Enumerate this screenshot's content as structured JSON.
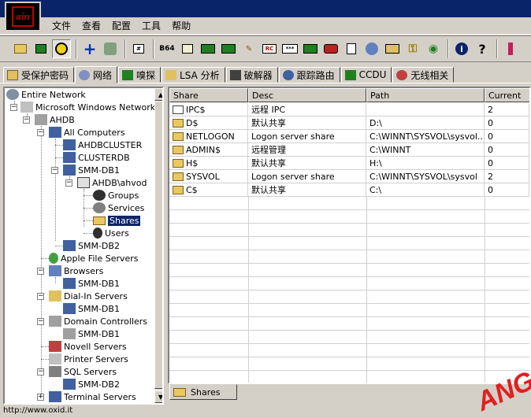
{
  "app": {
    "icon_text": "ain"
  },
  "menu": [
    "文件",
    "查看",
    "配置",
    "工具",
    "帮助"
  ],
  "toolbar": {
    "icons": [
      "open-icon",
      "network-card-icon",
      "sniffer-hazard-icon",
      "add-icon",
      "recycle-icon",
      "hash-icon",
      "base64-icon",
      "lm-hash-icon",
      "mac-icon",
      "pwl-icon",
      "rdp-icon",
      "password-stars-icon",
      "console-icon",
      "mask-icon",
      "certificate-icon",
      "cisco-icon",
      "keychain-icon",
      "key-icon",
      "wireless-icon",
      "info-icon",
      "help-icon"
    ],
    "base64_label": "B64"
  },
  "tabs": [
    {
      "label": "受保护密码",
      "icon": "key-icon"
    },
    {
      "label": "网络",
      "icon": "network-icon",
      "active": true
    },
    {
      "label": "嗅探",
      "icon": "sniffer-icon"
    },
    {
      "label": "LSA 分析",
      "icon": "lsa-icon"
    },
    {
      "label": "破解器",
      "icon": "cracker-icon"
    },
    {
      "label": "跟踪路由",
      "icon": "traceroute-icon"
    },
    {
      "label": "CCDU",
      "icon": "ccdu-icon"
    },
    {
      "label": "无线相关",
      "icon": "wireless-icon"
    }
  ],
  "tree": {
    "entire_network": "Entire Network",
    "windows_network": "Microsoft Windows Network",
    "domain": "AHDB",
    "all_computers": "All Computers",
    "ahdbcluster": "AHDBCLUSTER",
    "clusterdb": "CLUSTERDB",
    "smm_db1": "SMM-DB1",
    "user_node": "AHDB\\ahvod",
    "groups": "Groups",
    "services": "Services",
    "shares": "Shares",
    "users": "Users",
    "smm_db2": "SMM-DB2",
    "apple": "Apple File Servers",
    "browsers": "Browsers",
    "browsers_child": "SMM-DB1",
    "dialin": "Dial-In Servers",
    "dialin_child": "SMM-DB1",
    "dc": "Domain Controllers",
    "dc_child": "SMM-DB1",
    "novell": "Novell Servers",
    "printer": "Printer Servers",
    "sql": "SQL Servers",
    "sql_child": "SMM-DB2",
    "terminal": "Terminal Servers"
  },
  "list": {
    "headers": [
      "Share",
      "Desc",
      "Path",
      "Current"
    ],
    "rows": [
      {
        "share": "IPC$",
        "desc": "远程 IPC",
        "path": "",
        "current": "2",
        "icon": "pipe-icon"
      },
      {
        "share": "D$",
        "desc": "默认共享",
        "path": "D:\\",
        "current": "0",
        "icon": "folder-icon"
      },
      {
        "share": "NETLOGON",
        "desc": "Logon server share",
        "path": "C:\\WINNT\\SYSVOL\\sysvol...",
        "current": "0",
        "icon": "folder-icon"
      },
      {
        "share": "ADMIN$",
        "desc": "远程管理",
        "path": "C:\\WINNT",
        "current": "0",
        "icon": "folder-icon"
      },
      {
        "share": "H$",
        "desc": "默认共享",
        "path": "H:\\",
        "current": "0",
        "icon": "folder-icon"
      },
      {
        "share": "SYSVOL",
        "desc": "Logon server share",
        "path": "C:\\WINNT\\SYSVOL\\sysvol",
        "current": "2",
        "icon": "folder-icon"
      },
      {
        "share": "C$",
        "desc": "默认共享",
        "path": "C:\\",
        "current": "0",
        "icon": "folder-icon"
      }
    ]
  },
  "bottom_tab": "Shares",
  "status": "http://www.oxid.it",
  "watermark": "ANG"
}
